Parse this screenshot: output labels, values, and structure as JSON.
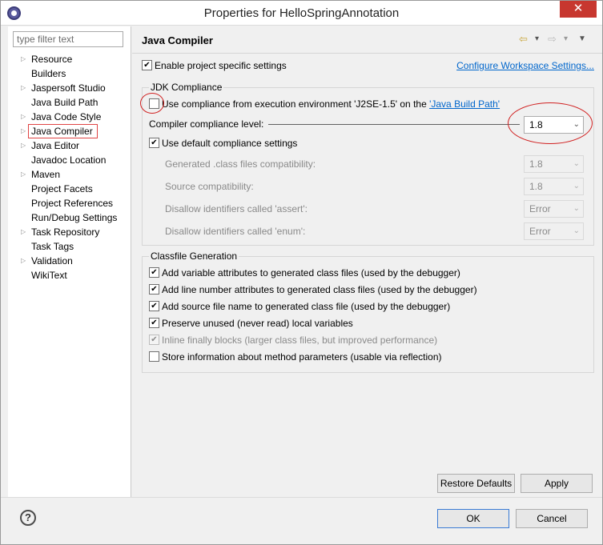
{
  "window": {
    "title": "Properties for HelloSpringAnnotation",
    "close_glyph": "✕"
  },
  "sidebar": {
    "filter_placeholder": "type filter text",
    "items": [
      {
        "label": "Resource",
        "expandable": true
      },
      {
        "label": "Builders",
        "expandable": false
      },
      {
        "label": "Jaspersoft Studio",
        "expandable": true
      },
      {
        "label": "Java Build Path",
        "expandable": false
      },
      {
        "label": "Java Code Style",
        "expandable": true
      },
      {
        "label": "Java Compiler",
        "expandable": true,
        "selected": true
      },
      {
        "label": "Java Editor",
        "expandable": true
      },
      {
        "label": "Javadoc Location",
        "expandable": false
      },
      {
        "label": "Maven",
        "expandable": true
      },
      {
        "label": "Project Facets",
        "expandable": false
      },
      {
        "label": "Project References",
        "expandable": false
      },
      {
        "label": "Run/Debug Settings",
        "expandable": false
      },
      {
        "label": "Task Repository",
        "expandable": true
      },
      {
        "label": "Task Tags",
        "expandable": false
      },
      {
        "label": "Validation",
        "expandable": true
      },
      {
        "label": "WikiText",
        "expandable": false
      }
    ]
  },
  "page": {
    "title": "Java Compiler",
    "project_specific_label": "Enable project specific settings",
    "configure_link": "Configure Workspace Settings...",
    "jdk": {
      "group_title": "JDK Compliance",
      "use_env_label": "Use compliance from execution environment 'J2SE-1.5' on the ",
      "build_path_link": "'Java Build Path'",
      "compliance_level_label": "Compiler compliance level:",
      "compliance_level_value": "1.8",
      "use_default_label": "Use default compliance settings",
      "generated_label": "Generated .class files compatibility:",
      "generated_value": "1.8",
      "source_label": "Source compatibility:",
      "source_value": "1.8",
      "assert_label": "Disallow identifiers called 'assert':",
      "assert_value": "Error",
      "enum_label": "Disallow identifiers called 'enum':",
      "enum_value": "Error"
    },
    "classfile": {
      "group_title": "Classfile Generation",
      "options": [
        {
          "label": "Add variable attributes to generated class files (used by the debugger)",
          "checked": true
        },
        {
          "label": "Add line number attributes to generated class files (used by the debugger)",
          "checked": true
        },
        {
          "label": "Add source file name to generated class file (used by the debugger)",
          "checked": true
        },
        {
          "label": "Preserve unused (never read) local variables",
          "checked": true
        },
        {
          "label": "Inline finally blocks (larger class files, but improved performance)",
          "checked": true,
          "disabled": true
        },
        {
          "label": "Store information about method parameters (usable via reflection)",
          "checked": false
        }
      ]
    },
    "restore_defaults_label": "Restore Defaults",
    "apply_label": "Apply"
  },
  "footer": {
    "help_glyph": "?",
    "ok_label": "OK",
    "cancel_label": "Cancel"
  },
  "icons": {
    "back_arrow": "⇦",
    "dropdown": "▾",
    "forward_arrow": "⇨",
    "menu": "▼",
    "tree_arrow": "▷",
    "combo_chevron": "⌄"
  },
  "colors": {
    "link": "#0066cc",
    "annotation_red": "#d02020",
    "close_red": "#c7372f"
  }
}
